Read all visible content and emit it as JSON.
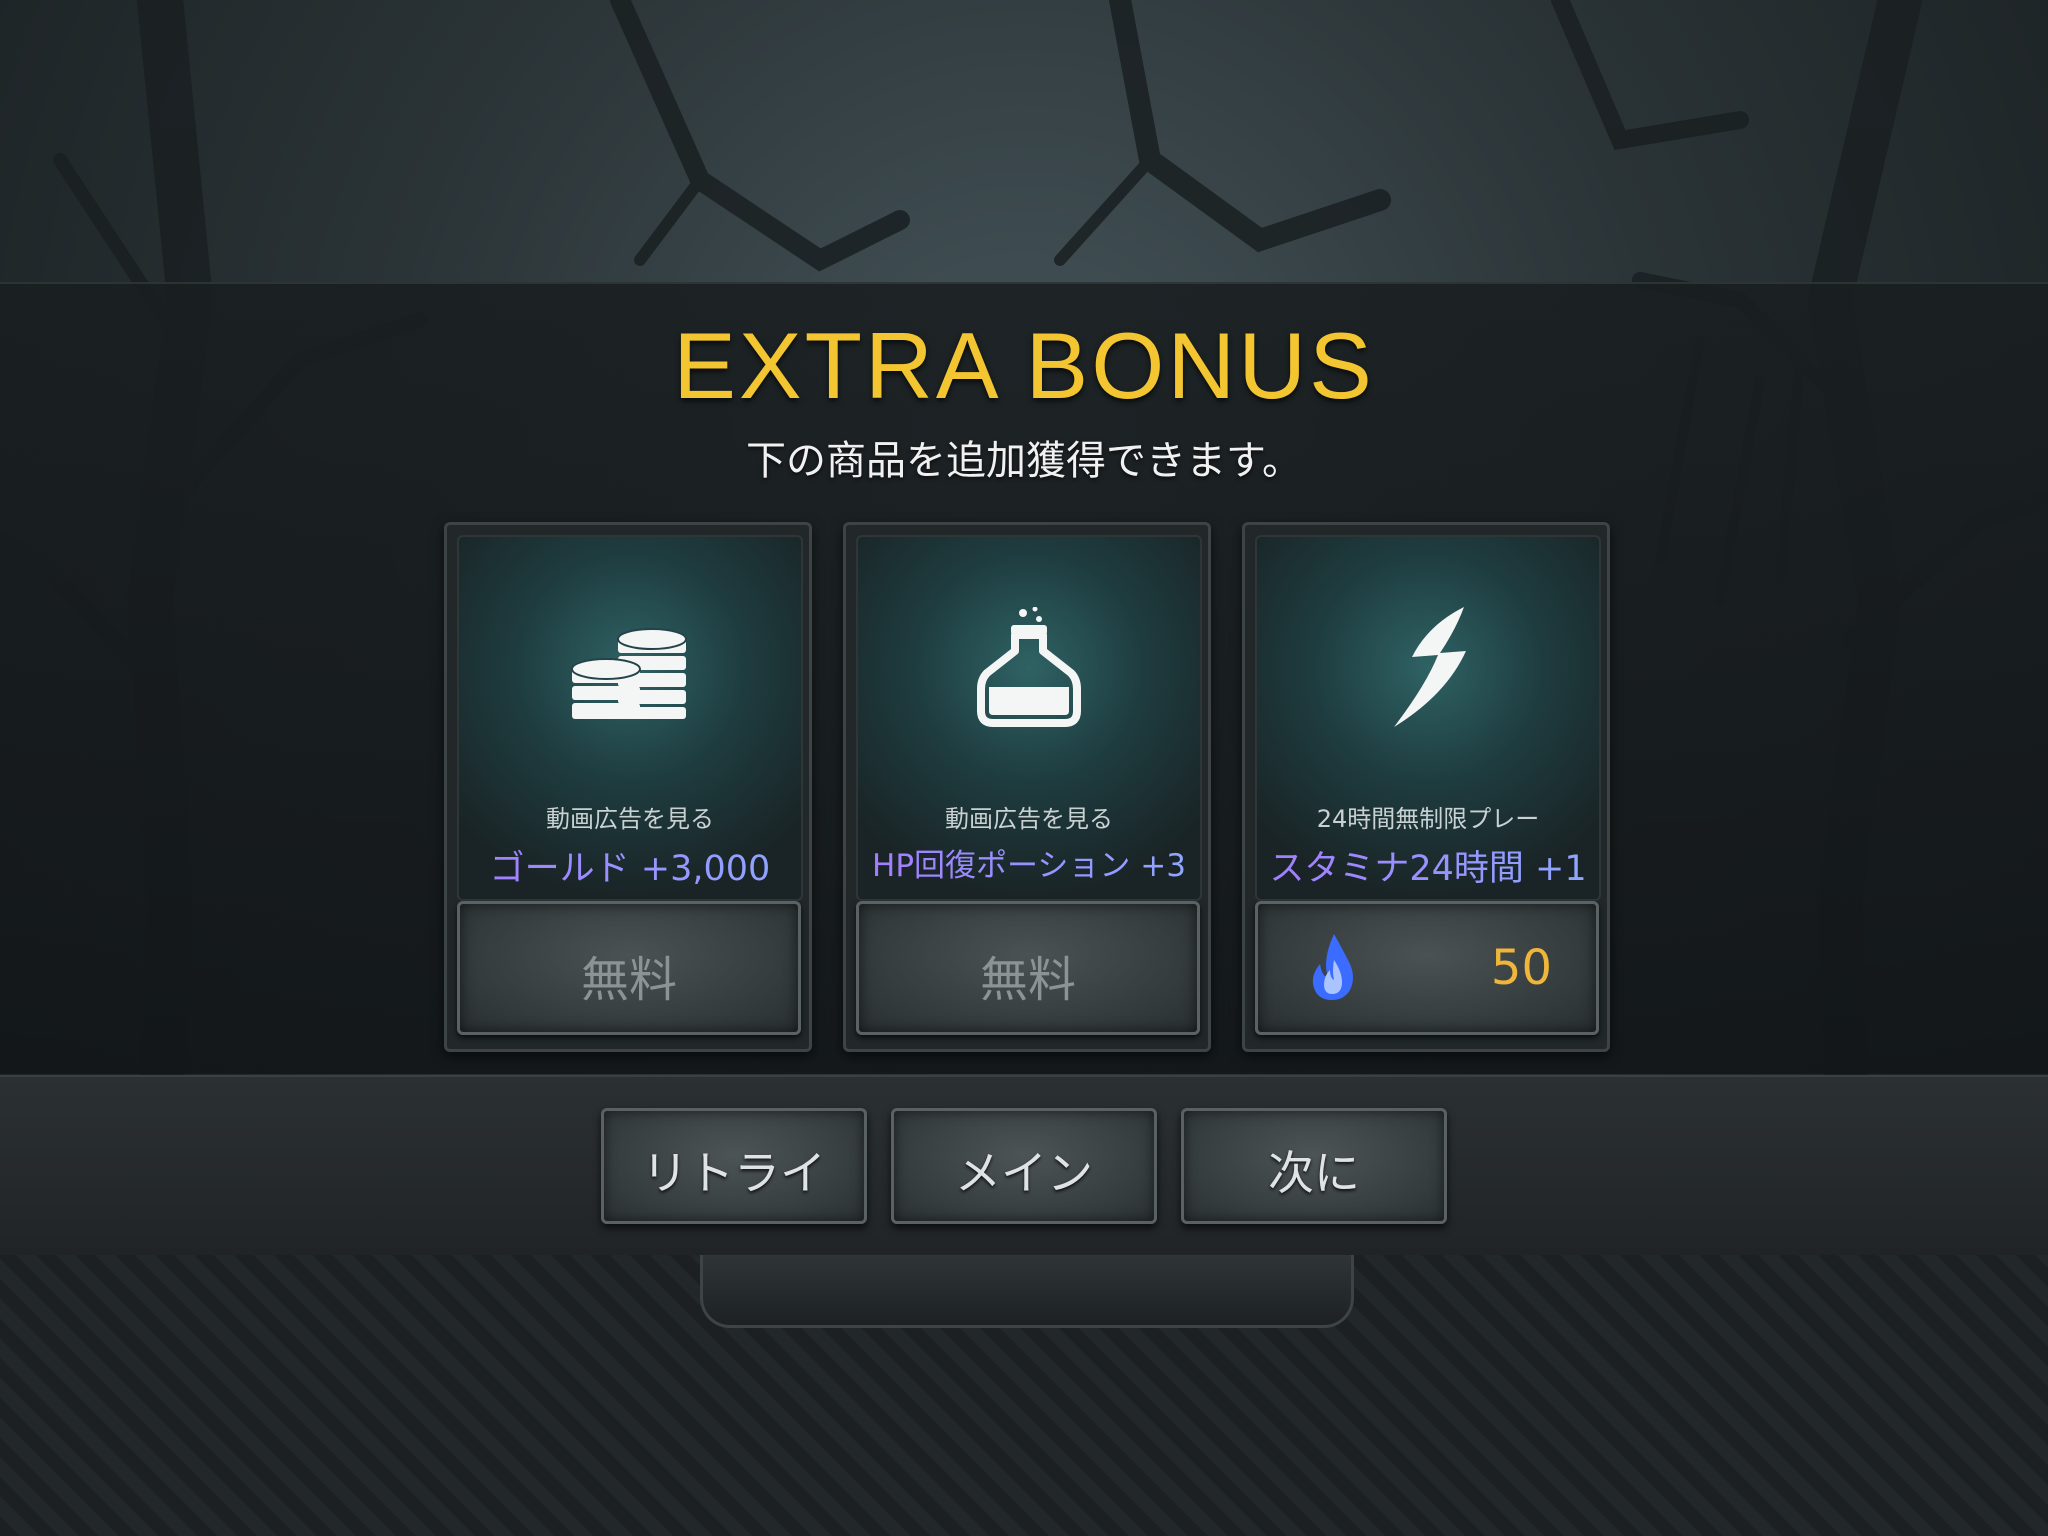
{
  "header": {
    "title": "EXTRA BONUS",
    "subtitle": "下の商品を追加獲得できます。"
  },
  "cards": [
    {
      "icon": "coins-icon",
      "caption": "動画広告を見る",
      "reward": "ゴールド +3,000",
      "button_label": "無料"
    },
    {
      "icon": "potion-flask-icon",
      "caption": "動画広告を見る",
      "reward": "HP回復ポーション +3",
      "button_label": "無料"
    },
    {
      "icon": "lightning-bolt-icon",
      "caption": "24時間無制限プレー",
      "reward": "スタミナ24時間 +1",
      "button_icon": "blue-flame-icon",
      "button_cost": "50"
    }
  ],
  "actions": {
    "retry_label": "リトライ",
    "main_label": "メイン",
    "next_label": "次に"
  },
  "colors": {
    "title": "#f3c531",
    "reward_gradient_start": "#a37cff",
    "reward_gradient_end": "#8ea8ff",
    "cost": "#f0b63a",
    "flame": "#3b6cff"
  }
}
